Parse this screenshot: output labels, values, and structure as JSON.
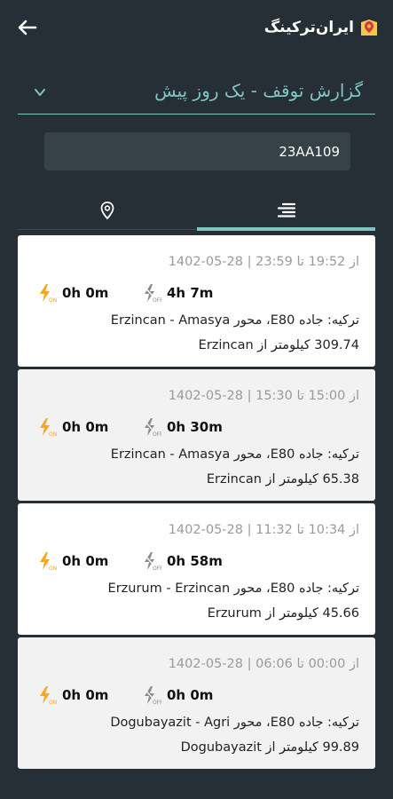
{
  "header": {
    "brand_name": "ایران‌ترکینگ",
    "accent": "#7fc6c1",
    "logo_color": "#f2c94c"
  },
  "report": {
    "title": "گزارش توقف - یک روز پیش"
  },
  "vehicle": {
    "plate": "23AA109"
  },
  "tabs": [
    {
      "name": "map",
      "icon": "location-pin-icon",
      "active": false
    },
    {
      "name": "list",
      "icon": "list-icon",
      "active": true
    }
  ],
  "stops": [
    {
      "time": "از 19:52 تا 23:59 | 28-05-1402",
      "on_duration": "0h 0m",
      "off_duration": "4h 7m",
      "road": "ترکیه: جاده E80، محور Erzincan - Amasya",
      "distance": "309.74 کیلومتر از Erzincan"
    },
    {
      "time": "از 15:00 تا 15:30 | 28-05-1402",
      "on_duration": "0h 0m",
      "off_duration": "0h 30m",
      "road": "ترکیه: جاده E80، محور Erzincan - Amasya",
      "distance": "65.38 کیلومتر از Erzincan"
    },
    {
      "time": "از 10:34 تا 11:32 | 28-05-1402",
      "on_duration": "0h 0m",
      "off_duration": "0h 58m",
      "road": "ترکیه: جاده E80، محور Erzurum - Erzincan",
      "distance": "45.66 کیلومتر از Erzurum"
    },
    {
      "time": "از 00:00 تا 06:06 | 28-05-1402",
      "on_duration": "0h 0m",
      "off_duration": "0h 0m",
      "road": "ترکیه: جاده E80، محور Dogubayazit - Agri",
      "distance": "99.89 کیلومتر از Dogubayazit"
    }
  ]
}
